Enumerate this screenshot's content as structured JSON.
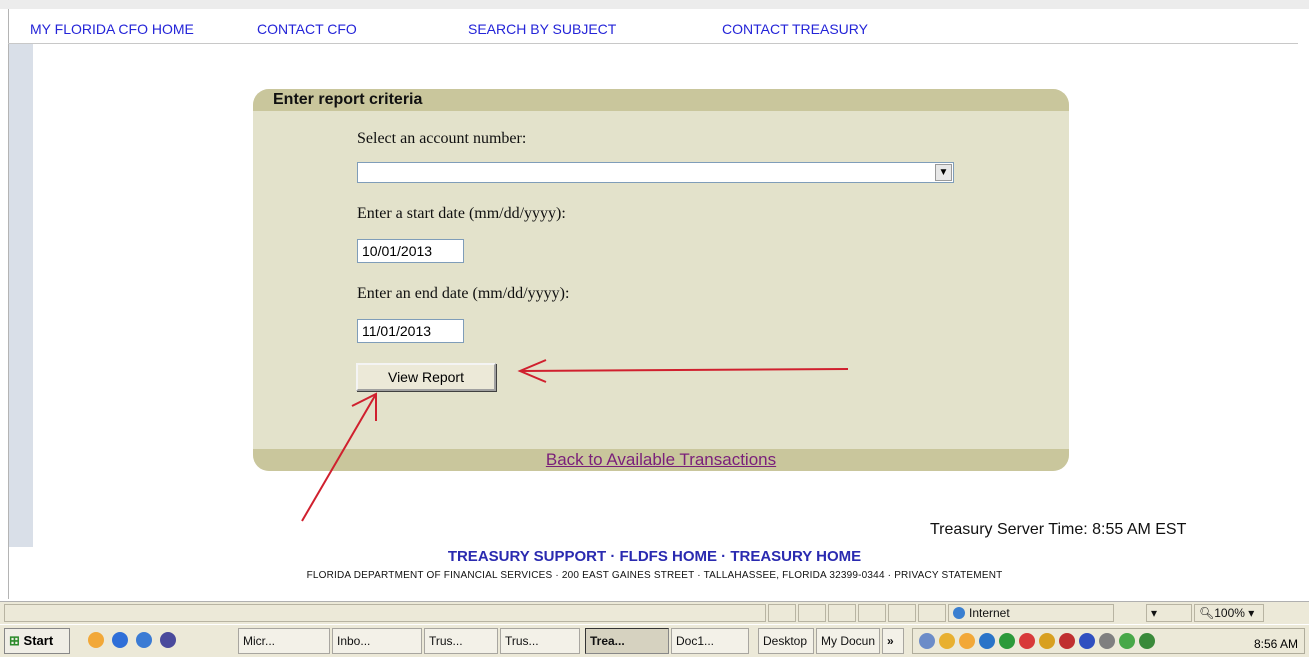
{
  "nav": {
    "items": [
      "MY FLORIDA CFO HOME",
      "CONTACT CFO",
      "SEARCH BY SUBJECT",
      "CONTACT TREASURY"
    ]
  },
  "panel": {
    "title": "Enter report criteria",
    "account_label": "Select an account number:",
    "account_value": "",
    "start_label": "Enter a start date (mm/dd/yyyy):",
    "start_value": "10/01/2013",
    "end_label": "Enter an end date (mm/dd/yyyy):",
    "end_value": "11/01/2013",
    "view_button": "View Report",
    "back_link": "Back to Available Transactions"
  },
  "server_time": "Treasury Server Time: 8:55 AM EST",
  "footer": {
    "links": "TREASURY SUPPORT · FLDFS HOME · TREASURY HOME",
    "address": "FLORIDA DEPARTMENT OF FINANCIAL SERVICES · 200 EAST GAINES STREET · TALLAHASSEE, FLORIDA 32399-0344 · PRIVACY STATEMENT"
  },
  "statusbar": {
    "zone": "Internet",
    "zoom": "100%"
  },
  "taskbar": {
    "start": "Start",
    "buttons": [
      "Micr...",
      "Inbo...",
      "Trus...",
      "Trus...",
      "Trea...",
      "Doc1..."
    ],
    "desktop": "Desktop",
    "my_docs": "My Docun",
    "chevron": "»",
    "clock": "8:56 AM"
  },
  "colors": {
    "panel_bg": "#e3e2cb",
    "panel_header": "#c9c69c",
    "nav_link": "#2424d8",
    "annotation_arrow": "#d0202e"
  }
}
